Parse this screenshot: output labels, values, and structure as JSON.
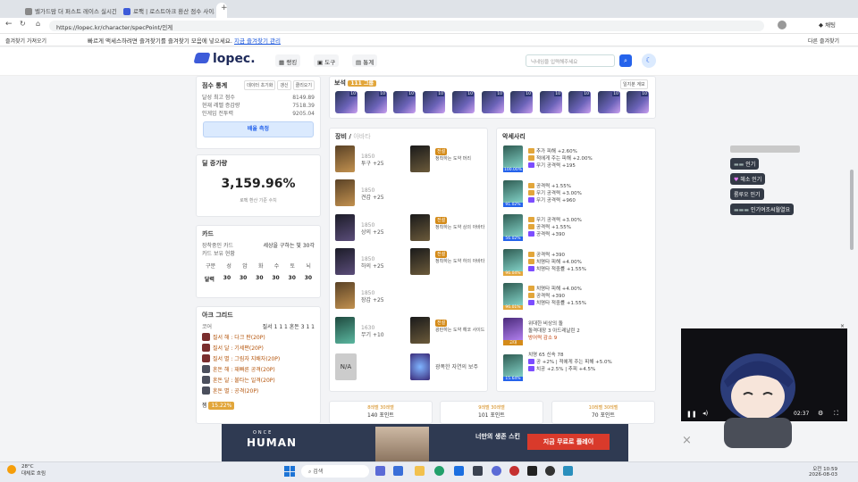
{
  "browser": {
    "tabs": [
      {
        "label": "벨가드맘 더 퍼스트 레이스 실시간"
      },
      {
        "label": "로팩 | 로스트아크 환산 점수 사이트"
      },
      {
        "label": "로펙 | 로스트아크 환산 점수 사이트"
      }
    ],
    "url": "https://lopec.kr/character/specPoint/인게",
    "notice": "빠르게 액세스하려면 즐겨찾기를 즐겨찾기 모음에 넣으세요.",
    "notice_link": "지금 즐겨찾기 관리",
    "import_label": "즐겨찾기 가져오기",
    "other_fav": "다른 즐겨찾기",
    "profile_label": "채팅"
  },
  "header": {
    "logo": "lopec.",
    "nav": [
      "랭킹",
      "도구",
      "통계"
    ],
    "search_placeholder": "닉네임을 입력해주세요"
  },
  "score_stats": {
    "title": "점수 통계",
    "buttons": [
      "데이터 초기화",
      "갱신",
      "클리오기"
    ],
    "rows": [
      {
        "label": "달성 최고 점수",
        "value": "8149.89"
      },
      {
        "label": "현재 레벨 증감량",
        "value": "7518.39"
      },
      {
        "label": "인게임 전투력",
        "value": "9205.04"
      }
    ],
    "measure_btn": "배율 측정"
  },
  "deal_card": {
    "title": "딜 증가량",
    "value": "3,159.96%",
    "sub": "로펙 환산 기준 수치"
  },
  "card_section": {
    "title": "카드",
    "rows": [
      {
        "label": "장착중인 카드",
        "value": "세상을 구하는 빛 30각"
      },
      {
        "label": "카드 보유 현황",
        "value": ""
      }
    ],
    "headers": [
      "구분",
      "성",
      "암",
      "화",
      "수",
      "토",
      "뇌"
    ],
    "values": [
      "달력",
      "30",
      "30",
      "30",
      "30",
      "30",
      "30"
    ]
  },
  "arc_grid": {
    "title": "아크 그리드",
    "row0": {
      "label": "코어",
      "value": "질서 1 1 1 혼돈 3 1 1"
    },
    "items": [
      "질서 해 : 다크 판(20P)",
      "질서 달 : 기세편(20P)",
      "질서 별 : 그림자 지배자(20P)",
      "혼돈 해 : 재빠른 공격(20P)",
      "혼돈 달 : 불타는 일격(20P)",
      "혼돈 별 : 공격(20P)"
    ],
    "footer_label": "젬",
    "footer_value": "15.22%"
  },
  "gems": {
    "title": "보석",
    "badge": "111 그룹",
    "btn": "일지분 계보",
    "levels": [
      "10",
      "10",
      "10",
      "10",
      "10",
      "10",
      "10",
      "10",
      "10",
      "10",
      "10"
    ]
  },
  "equipment": {
    "title": "장비",
    "tab2": "아바타",
    "items": [
      {
        "quality": "1850",
        "name": "투구 +25",
        "q": "품질 100"
      },
      {
        "quality": "1850",
        "name": "견갑 +25",
        "q": "품질 100"
      },
      {
        "quality": "1850",
        "name": "상의 +25",
        "q": "품질 100"
      },
      {
        "quality": "1850",
        "name": "하의 +25",
        "q": "품질 100"
      },
      {
        "quality": "1850",
        "name": "장갑 +25",
        "q": "품질 100"
      },
      {
        "quality": "1630",
        "name": "무기 +10",
        "q": "품질 100"
      }
    ],
    "avatars": [
      {
        "badge": "전설",
        "name": "정착하는 도약 머리",
        "q": "전설 +2%"
      },
      {
        "badge": "전설",
        "name": "정착하는 도약 상의 아바타",
        "q": "전설 +2%"
      },
      {
        "badge": "전설",
        "name": "정착하는 도약 하의 아바타",
        "q": "전설 +2%"
      },
      {
        "badge": "전설",
        "name": "광란하는 도약 해코 사이드",
        "q": "전설 +2%"
      }
    ],
    "stone": "N/A",
    "bracelet": "광폭한 자연의 보주",
    "bracelet_badge": "유물"
  },
  "accessories": {
    "title": "악세사리",
    "items": [
      {
        "pct": "100.00%",
        "lines": [
          "추가 피해 +2.60%",
          "적에게 주는 피해 +2.00%",
          "무기 공격력 +195"
        ]
      },
      {
        "pct": "91.02%",
        "lines": [
          "공격력 +1.55%",
          "무기 공격력 +3.00%",
          "무기 공격력 +960"
        ]
      },
      {
        "pct": "56.02%",
        "lines": [
          "무기 공격력 +3.00%",
          "공격력 +1.55%",
          "공격력 +390"
        ]
      },
      {
        "pct": "96.04%",
        "lines": [
          "공격력 +390",
          "치명타 피해 +4.00%",
          "치명타 적중률 +1.55%"
        ]
      },
      {
        "pct": "96.01%",
        "lines": [
          "치명타 피해 +4.00%",
          "공격력 +390",
          "치명타 적중률 +1.55%"
        ]
      },
      {
        "pct": "고대",
        "lines": [
          "위대한 비상의 돌",
          "돌격대장 3 아드레날린 2",
          "방어력 감소 9"
        ]
      },
      {
        "pct": "15.64%",
        "lines": [
          "치명 65 신속 78",
          "공 +2% | 적에게 주는 피해 +5.0%",
          "치공 +2.5% | 추피 +4.5%"
        ]
      }
    ]
  },
  "bottom_cards": [
    {
      "label": "8레벨 30레벨",
      "pts": "140 포인트"
    },
    {
      "label": "9레벨 30레벨",
      "pts": "101 포인트"
    },
    {
      "label": "10레벨 30레벨",
      "pts": "70 포인트"
    }
  ],
  "chat": [
    {
      "text": "인기"
    },
    {
      "text": "헤소 인기"
    },
    {
      "text": "룸루오 인기"
    },
    {
      "text": "인기여조씨월열요"
    }
  ],
  "video": {
    "time": "02:37"
  },
  "ad": {
    "brand": "HUMAN",
    "brand_top": "ONCE",
    "text1": "너만의 생존 스킨",
    "text2": "지금 무료로 플레이"
  },
  "taskbar": {
    "weather": "28°C",
    "weather_sub": "대체로 흐림",
    "search": "검색",
    "time": "오전 10:59",
    "date": "2026-08-03"
  }
}
